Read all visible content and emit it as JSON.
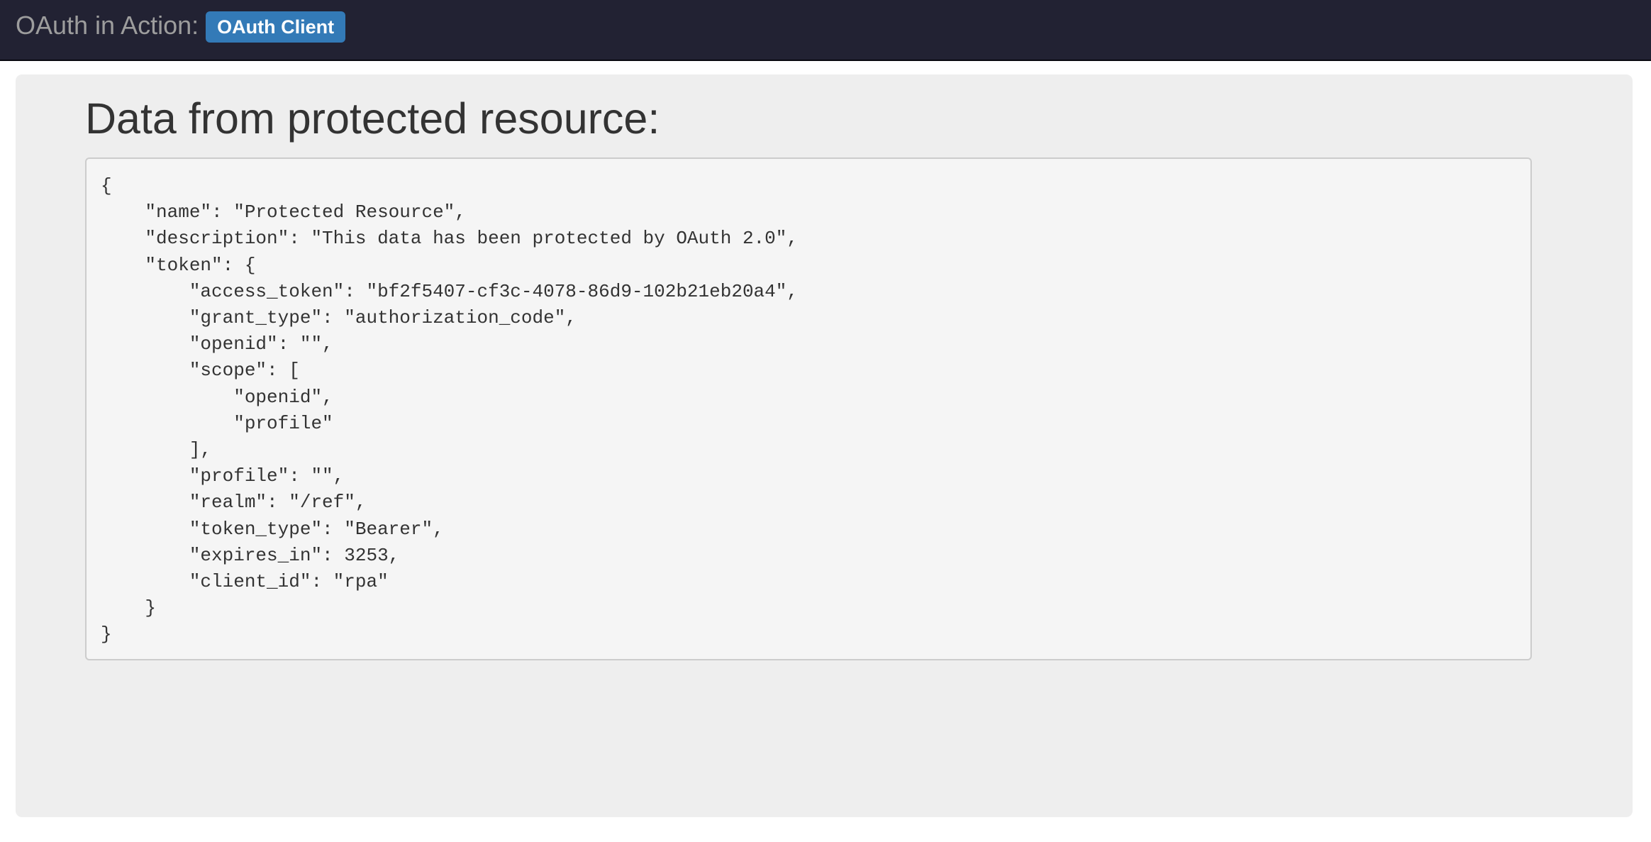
{
  "navbar": {
    "brand_text": "OAuth in Action:",
    "badge_text": "OAuth Client"
  },
  "main": {
    "heading": "Data from protected resource:",
    "resource_json": "{\n    \"name\": \"Protected Resource\",\n    \"description\": \"This data has been protected by OAuth 2.0\",\n    \"token\": {\n        \"access_token\": \"bf2f5407-cf3c-4078-86d9-102b21eb20a4\",\n        \"grant_type\": \"authorization_code\",\n        \"openid\": \"\",\n        \"scope\": [\n            \"openid\",\n            \"profile\"\n        ],\n        \"profile\": \"\",\n        \"realm\": \"/ref\",\n        \"token_type\": \"Bearer\",\n        \"expires_in\": 3253,\n        \"client_id\": \"rpa\"\n    }\n}"
  },
  "colors": {
    "navbar_bg": "#222233",
    "badge_bg": "#337ab7",
    "panel_bg": "#eeeeee",
    "code_bg": "#f5f5f5"
  }
}
